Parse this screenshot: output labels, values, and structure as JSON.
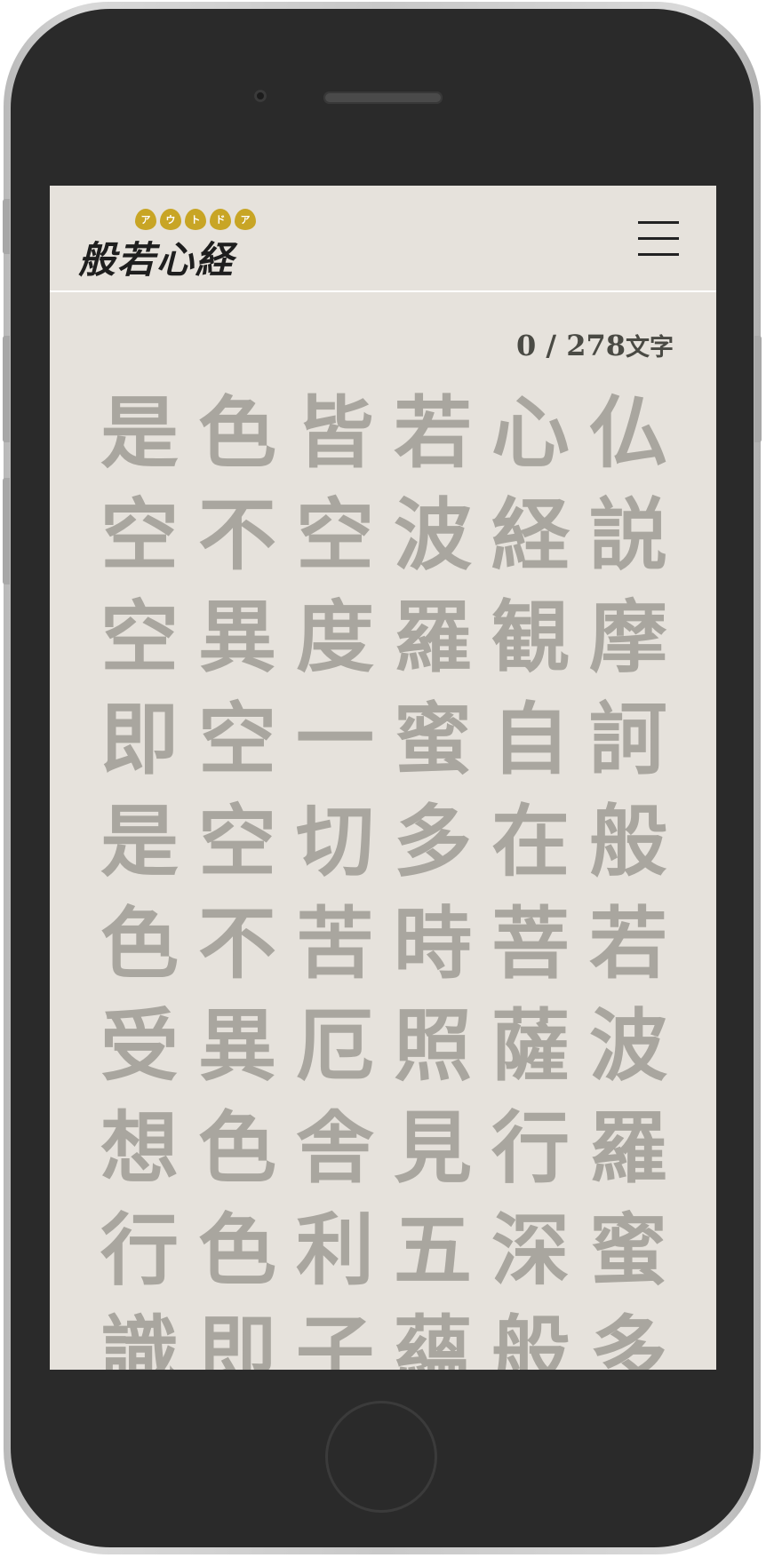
{
  "app": {
    "logo_ruby": [
      "ア",
      "ウ",
      "ト",
      "ド",
      "ア"
    ],
    "logo_text": "般若心経"
  },
  "counter": {
    "current": "0",
    "separator": "/",
    "total": "278",
    "unit": "文字"
  },
  "sutra_columns": [
    [
      "仏",
      "説",
      "摩",
      "訶",
      "般",
      "若",
      "波",
      "羅",
      "蜜",
      "多"
    ],
    [
      "心",
      "経",
      "観",
      "自",
      "在",
      "菩",
      "薩",
      "行",
      "深",
      "般"
    ],
    [
      "若",
      "波",
      "羅",
      "蜜",
      "多",
      "時",
      "照",
      "見",
      "五",
      "蘊"
    ],
    [
      "皆",
      "空",
      "度",
      "一",
      "切",
      "苦",
      "厄",
      "舎",
      "利",
      "子"
    ],
    [
      "色",
      "不",
      "異",
      "空",
      "空",
      "不",
      "異",
      "色",
      "色",
      "即"
    ],
    [
      "是",
      "空",
      "空",
      "即",
      "是",
      "色",
      "受",
      "想",
      "行",
      "識"
    ]
  ],
  "colors": {
    "screen_bg": "#e6e2dc",
    "char_color": "#a9a69f",
    "logo_accent": "#c8a525",
    "text_dark": "#1e1e1e"
  },
  "icons": {
    "menu": "hamburger-icon"
  }
}
